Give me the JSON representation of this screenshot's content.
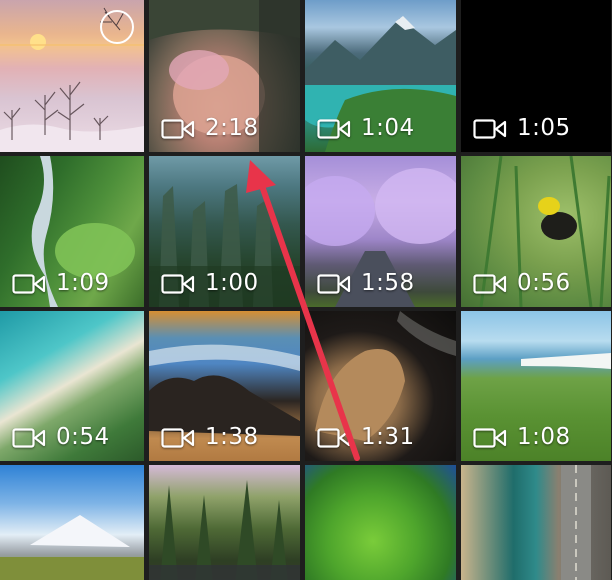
{
  "gallery": {
    "tiles": [
      {
        "scene": "sunset-snow-trees",
        "is_video": false,
        "duration": ""
      },
      {
        "scene": "child-closeup",
        "is_video": true,
        "duration": "2:18"
      },
      {
        "scene": "mountain-lake",
        "is_video": true,
        "duration": "1:04"
      },
      {
        "scene": "black-frame",
        "is_video": true,
        "duration": "1:05"
      },
      {
        "scene": "river-forest-aerial",
        "is_video": true,
        "duration": "1:09"
      },
      {
        "scene": "rock-pillars-forest",
        "is_video": true,
        "duration": "1:00"
      },
      {
        "scene": "purple-blossom-road",
        "is_video": true,
        "duration": "1:58"
      },
      {
        "scene": "yellow-bird-reeds",
        "is_video": true,
        "duration": "0:56"
      },
      {
        "scene": "turquoise-beach-aerial",
        "is_video": true,
        "duration": "0:54"
      },
      {
        "scene": "coastal-rocks",
        "is_video": true,
        "duration": "1:38"
      },
      {
        "scene": "rock-formation-dark",
        "is_video": true,
        "duration": "1:31"
      },
      {
        "scene": "sea-cliffs-meadow",
        "is_video": true,
        "duration": "1:08"
      },
      {
        "scene": "snowy-mountain-sky",
        "is_video": false,
        "duration": ""
      },
      {
        "scene": "forest-pond",
        "is_video": false,
        "duration": ""
      },
      {
        "scene": "green-tree-canopy",
        "is_video": false,
        "duration": ""
      },
      {
        "scene": "road-river-aerial",
        "is_video": false,
        "duration": ""
      }
    ]
  },
  "icons": {
    "video": "video-camera-icon",
    "select": "selection-circle-icon"
  },
  "annotation": {
    "arrow_color": "#e8344a",
    "arrow_points_to": "video-duration-2-18"
  }
}
